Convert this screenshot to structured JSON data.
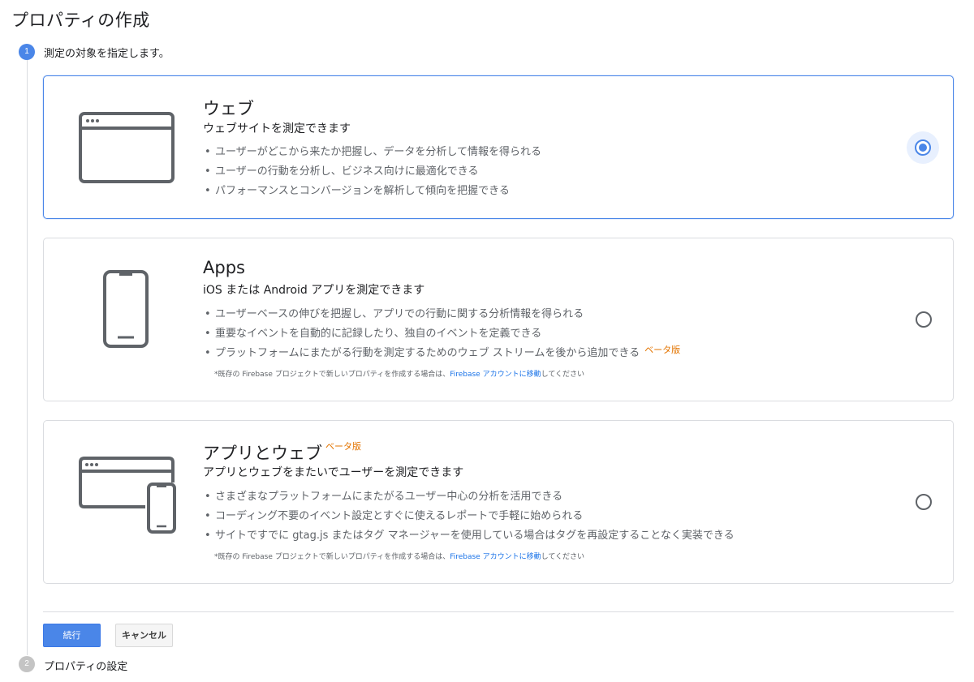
{
  "page": {
    "title": "プロパティの作成"
  },
  "steps": [
    {
      "number": "1",
      "label": "測定の対象を指定します。",
      "state": "active"
    },
    {
      "number": "2",
      "label": "プロパティの設定",
      "state": "inactive"
    }
  ],
  "options": {
    "web": {
      "title": "ウェブ",
      "subtitle": "ウェブサイトを測定できます",
      "features": [
        "ユーザーがどこから来たか把握し、データを分析して情報を得られる",
        "ユーザーの行動を分析し、ビジネス向けに最適化できる",
        "パフォーマンスとコンバージョンを解析して傾向を把握できる"
      ],
      "selected": true,
      "icon": "browser-window-icon"
    },
    "apps": {
      "title": "Apps",
      "subtitle": "iOS または Android アプリを測定できます",
      "features": [
        "ユーザーベースの伸びを把握し、アプリでの行動に関する分析情報を得られる",
        "重要なイベントを自動的に記録したり、独自のイベントを定義できる",
        "プラットフォームにまたがる行動を測定するためのウェブ ストリームを後から追加できる"
      ],
      "feature_beta": "ベータ版",
      "note_prefix": "*既存の Firebase プロジェクトで新しいプロパティを作成する場合は、",
      "note_link": "Firebase アカウントに移動",
      "note_suffix": "してください",
      "selected": false,
      "icon": "smartphone-icon"
    },
    "app_web": {
      "title": "アプリとウェブ",
      "title_beta": "ベータ版",
      "subtitle": "アプリとウェブをまたいでユーザーを測定できます",
      "features": [
        "さまざまなプラットフォームにまたがるユーザー中心の分析を活用できる",
        "コーディング不要のイベント設定とすぐに使えるレポートで手軽に始められる",
        "サイトですでに gtag.js またはタグ マネージャーを使用している場合はタグを再設定することなく実装できる"
      ],
      "note_prefix": "*既存の Firebase プロジェクトで新しいプロパティを作成する場合は、",
      "note_link": "Firebase アカウントに移動",
      "note_suffix": "してください",
      "selected": false,
      "icon": "browser-and-phone-icon"
    }
  },
  "actions": {
    "continue_label": "続行",
    "cancel_label": "キャンセル"
  },
  "colors": {
    "accent": "#4a86e8",
    "beta": "#e37400",
    "link": "#1a73e8",
    "icon": "#5f6368"
  }
}
